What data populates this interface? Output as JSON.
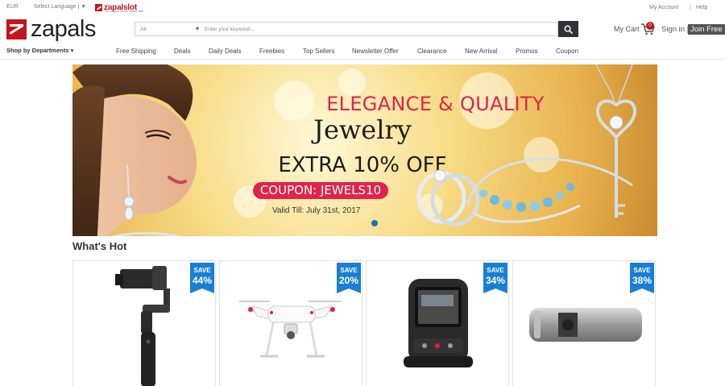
{
  "top_bar": {
    "currency": "EUR",
    "language": "Select Language | ▼",
    "slot_brand": "zapalslot",
    "slot_tagline": "The Largest Online Sticker Mall",
    "my_account": "My Account",
    "help": "Help",
    "separator": "|"
  },
  "header": {
    "logo_text": "zapals",
    "search": {
      "category": "All",
      "placeholder": "Enter your keyword..."
    },
    "cart_label": "My Cart",
    "cart_count": "0",
    "sign_in": "Sign in |",
    "join_free": "Join Free"
  },
  "nav": {
    "departments": "Shop by Departments ▾",
    "items": [
      "Free Shipping",
      "Deals",
      "Daily Deals",
      "Freebies",
      "Top Sellers",
      "Newsletter Offer",
      "Clearance",
      "New Arrival",
      "Promos",
      "Coupon"
    ]
  },
  "banner": {
    "line1": "ELEGANCE & QUALITY",
    "line2": "Jewelry",
    "line3": "EXTRA 10% OFF",
    "coupon": "COUPON: JEWELS10",
    "valid": "Valid Till: July 31st, 2017"
  },
  "whats_hot": {
    "title": "What's Hot",
    "products": [
      {
        "save_label": "SAVE",
        "discount": "44%",
        "icon": "gimbal-stabilizer-icon"
      },
      {
        "save_label": "SAVE",
        "discount": "20%",
        "icon": "drone-icon"
      },
      {
        "save_label": "SAVE",
        "discount": "34%",
        "icon": "dash-camera-icon"
      },
      {
        "save_label": "SAVE",
        "discount": "38%",
        "icon": "bluetooth-speaker-icon"
      }
    ]
  },
  "colors": {
    "brand_red": "#c4141d",
    "coupon_pink": "#e0234c",
    "save_blue": "#1a7fd4",
    "search_button": "#2f3338"
  }
}
